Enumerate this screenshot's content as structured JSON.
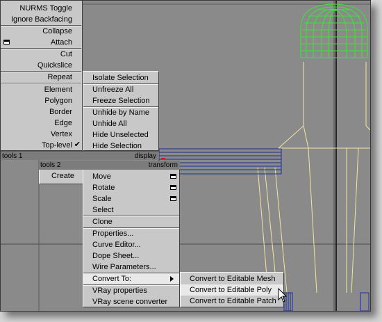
{
  "colors": {
    "viewport_bg": "#8a8a8a",
    "menu_bg": "#c8c8c8",
    "header_bg": "#7c7c7c",
    "wire_green": "#39e639",
    "wire_yellow": "#f0e8a0",
    "wire_blue": "#1a2c9a",
    "highlight": "#e9e9e9"
  },
  "quad_left": {
    "items": [
      {
        "label": "NURMS Toggle"
      },
      {
        "label": "Ignore Backfacing"
      },
      {
        "label": "Collapse"
      },
      {
        "label": "Attach",
        "icon": "settings-box-icon"
      },
      {
        "label": "Cut"
      },
      {
        "label": "Quickslice"
      },
      {
        "label": "Repeat"
      },
      {
        "label": "Element"
      },
      {
        "label": "Polygon"
      },
      {
        "label": "Border"
      },
      {
        "label": "Edge"
      },
      {
        "label": "Vertex"
      },
      {
        "label": "Top-level",
        "checked": true,
        "check_icon": "checkmark-icon"
      }
    ],
    "header_tools1": "tools 1",
    "header_display": "display",
    "header_tools2": "tools 2",
    "create_label": "Create"
  },
  "quad_display": {
    "items": [
      "Isolate Selection",
      "Unfreeze All",
      "Freeze Selection",
      "Unhide by Name",
      "Unhide All",
      "Hide Unselected",
      "Hide Selection"
    ]
  },
  "quad_transform": {
    "header": "transform",
    "items": [
      {
        "label": "Move",
        "icon": "settings-box-icon"
      },
      {
        "label": "Rotate",
        "icon": "settings-box-icon"
      },
      {
        "label": "Scale",
        "icon": "settings-box-icon"
      },
      {
        "label": "Select"
      },
      {
        "label": "Clone"
      },
      {
        "label": "Properties..."
      },
      {
        "label": "Curve Editor..."
      },
      {
        "label": "Dope Sheet..."
      },
      {
        "label": "Wire Parameters..."
      },
      {
        "label": "Convert To:",
        "submenu": true,
        "highlighted": true
      },
      {
        "label": "VRay properties"
      },
      {
        "label": "VRay scene converter"
      }
    ]
  },
  "convert_submenu": {
    "items": [
      {
        "label": "Convert to Editable Mesh"
      },
      {
        "label": "Convert to Editable Poly",
        "highlighted": true
      },
      {
        "label": "Convert to Editable Patch"
      }
    ]
  }
}
